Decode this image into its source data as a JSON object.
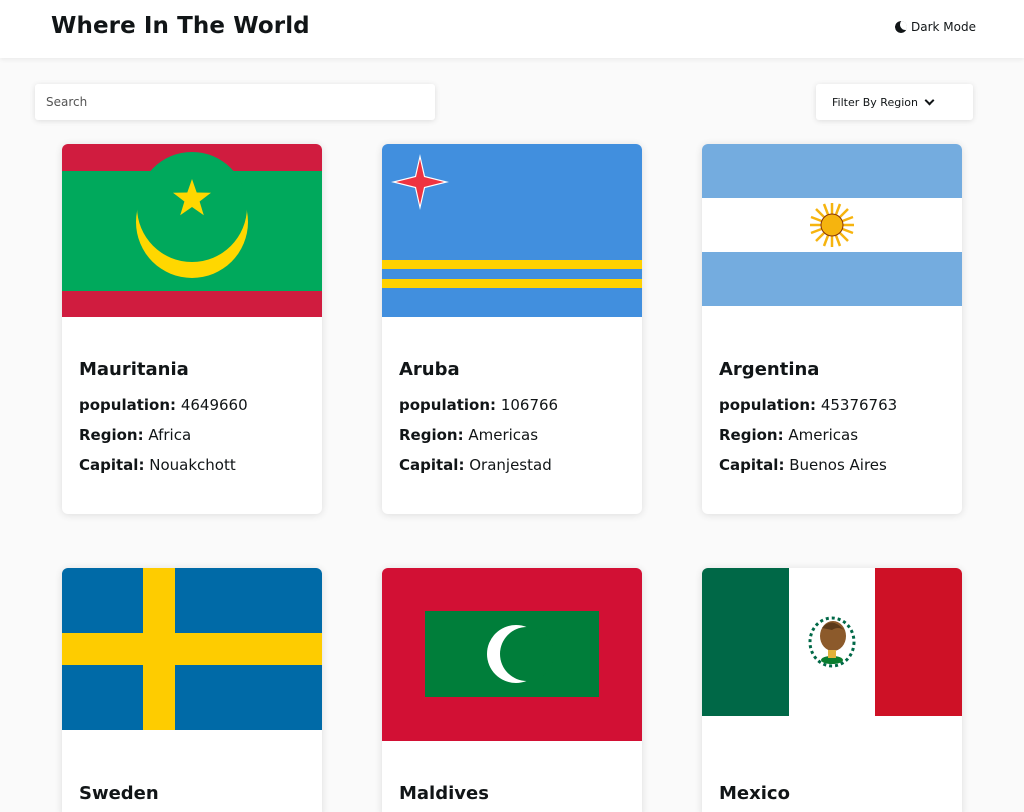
{
  "header": {
    "title": "Where In The World",
    "theme_toggle_label": "Dark Mode"
  },
  "search": {
    "placeholder": "Search"
  },
  "filter": {
    "label": "Filter By Region"
  },
  "labels": {
    "population": "population:",
    "region": "Region:",
    "capital": "Capital:"
  },
  "countries": [
    {
      "name": "Mauritania",
      "population": "4649660",
      "region": "Africa",
      "capital": "Nouakchott"
    },
    {
      "name": "Aruba",
      "population": "106766",
      "region": "Americas",
      "capital": "Oranjestad"
    },
    {
      "name": "Argentina",
      "population": "45376763",
      "region": "Americas",
      "capital": "Buenos Aires"
    },
    {
      "name": "Sweden"
    },
    {
      "name": "Maldives"
    },
    {
      "name": "Mexico"
    }
  ]
}
